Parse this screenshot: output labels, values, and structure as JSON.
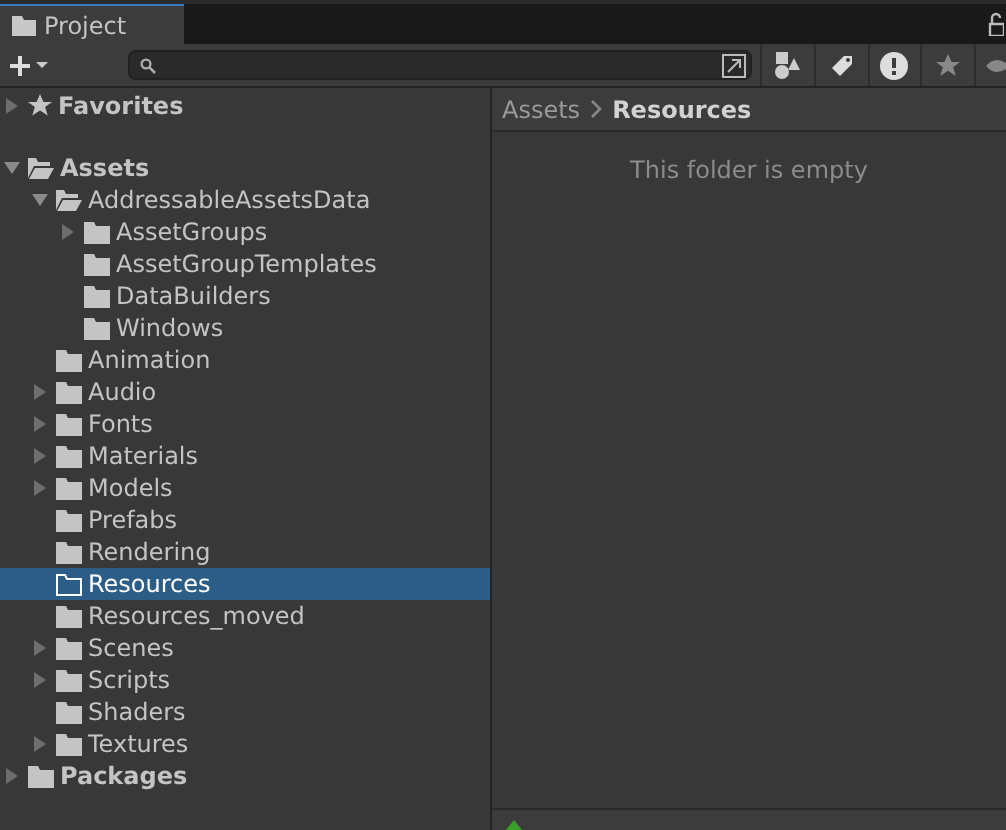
{
  "window": {
    "tab": "Project"
  },
  "favorites": {
    "label": "Favorites",
    "expanded": false,
    "selected": false
  },
  "tree": [
    {
      "label": "Assets",
      "expanded": true,
      "selected": false,
      "children": [
        {
          "label": "AddressableAssetsData",
          "expanded": true,
          "selected": false,
          "children": [
            {
              "label": "AssetGroups",
              "expanded": false,
              "selected": false
            },
            {
              "label": "AssetGroupTemplates",
              "selected": false
            },
            {
              "label": "DataBuilders",
              "selected": false
            },
            {
              "label": "Windows",
              "selected": false
            }
          ]
        },
        {
          "label": "Animation",
          "selected": false
        },
        {
          "label": "Audio",
          "expanded": false,
          "selected": false
        },
        {
          "label": "Fonts",
          "expanded": false,
          "selected": false
        },
        {
          "label": "Materials",
          "expanded": false,
          "selected": false
        },
        {
          "label": "Models",
          "expanded": false,
          "selected": false
        },
        {
          "label": "Prefabs",
          "selected": false
        },
        {
          "label": "Rendering",
          "selected": false
        },
        {
          "label": "Resources",
          "selected": true
        },
        {
          "label": "Resources_moved",
          "selected": false
        },
        {
          "label": "Scenes",
          "expanded": false,
          "selected": false
        },
        {
          "label": "Scripts",
          "expanded": false,
          "selected": false
        },
        {
          "label": "Shaders",
          "selected": false
        },
        {
          "label": "Textures",
          "expanded": false,
          "selected": false
        }
      ]
    },
    {
      "label": "Packages",
      "expanded": false,
      "selected": false
    }
  ],
  "breadcrumb": [
    {
      "label": "Assets",
      "current": false
    },
    {
      "label": "Resources",
      "current": true
    }
  ],
  "content": {
    "empty_message": "This folder is empty"
  }
}
